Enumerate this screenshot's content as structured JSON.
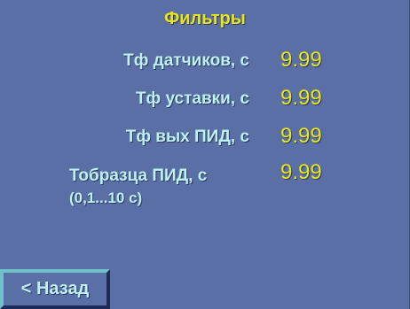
{
  "screen": {
    "title": "Фильтры"
  },
  "filters": [
    {
      "label": "Тф датчиков, с",
      "value": "9.99"
    },
    {
      "label": "Тф уставки, с",
      "value": "9.99"
    },
    {
      "label": "Тф вых ПИД, с",
      "value": "9.99"
    },
    {
      "label": "Тобразца ПИД, с",
      "sub_label": "(0,1...10 с)",
      "value": "9.99"
    }
  ],
  "buttons": {
    "back_label": "< Назад"
  },
  "colors": {
    "background": "#5a6fa5",
    "label": "#bff0f2",
    "value": "#e8e61a"
  }
}
